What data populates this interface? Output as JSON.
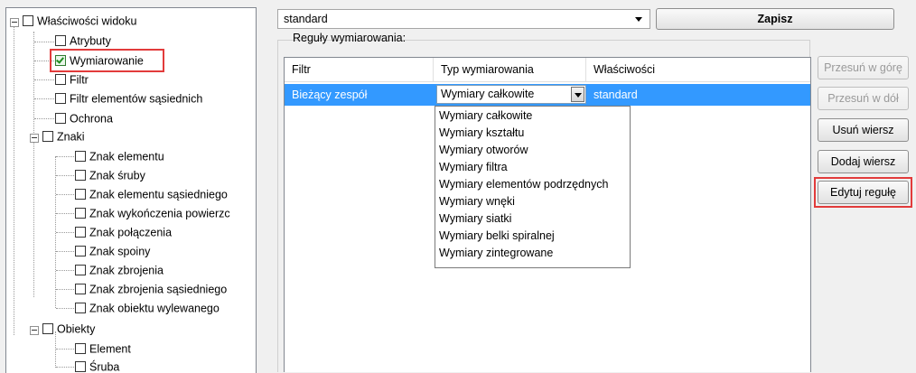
{
  "tree": {
    "nodes": [
      {
        "label": "Właściwości widoku",
        "checked": false
      },
      {
        "label": "Atrybuty",
        "checked": false
      },
      {
        "label": "Wymiarowanie",
        "checked": true
      },
      {
        "label": "Filtr",
        "checked": false
      },
      {
        "label": "Filtr elementów sąsiednich",
        "checked": false
      },
      {
        "label": "Ochrona",
        "checked": false
      },
      {
        "label": "Znaki",
        "checked": false
      },
      {
        "label": "Znak elementu",
        "checked": false
      },
      {
        "label": "Znak śruby",
        "checked": false
      },
      {
        "label": "Znak elementu sąsiedniego",
        "checked": false
      },
      {
        "label": "Znak wykończenia powierzc",
        "checked": false
      },
      {
        "label": "Znak połączenia",
        "checked": false
      },
      {
        "label": "Znak spoiny",
        "checked": false
      },
      {
        "label": "Znak zbrojenia",
        "checked": false
      },
      {
        "label": "Znak zbrojenia sąsiedniego",
        "checked": false
      },
      {
        "label": "Znak obiektu wylewanego",
        "checked": false
      },
      {
        "label": "Obiekty",
        "checked": false
      },
      {
        "label": "Element",
        "checked": false
      },
      {
        "label": "Śruba",
        "checked": false
      }
    ]
  },
  "profile": {
    "value": "standard",
    "save_label": "Zapisz"
  },
  "rules": {
    "group_label": "Reguły wymiarowania:",
    "columns": [
      "Filtr",
      "Typ wymiarowania",
      "Właściwości"
    ],
    "selected_row": {
      "filter": "Bieżący zespół",
      "type": "Wymiary całkowite",
      "properties": "standard"
    },
    "dropdown_options": [
      "Wymiary całkowite",
      "Wymiary kształtu",
      "Wymiary otworów",
      "Wymiary filtra",
      "Wymiary elementów podrzędnych",
      "Wymiary wnęki",
      "Wymiary siatki",
      "Wymiary belki spiralnej",
      "Wymiary zintegrowane"
    ]
  },
  "buttons": {
    "move_up": "Przesuń w górę",
    "move_down": "Przesuń w dół",
    "delete_row": "Usuń wiersz",
    "add_row": "Dodaj wiersz",
    "edit_rule": "Edytuj regułę"
  },
  "colors": {
    "selection": "#3399ff",
    "highlight_box": "#e23b3b"
  }
}
